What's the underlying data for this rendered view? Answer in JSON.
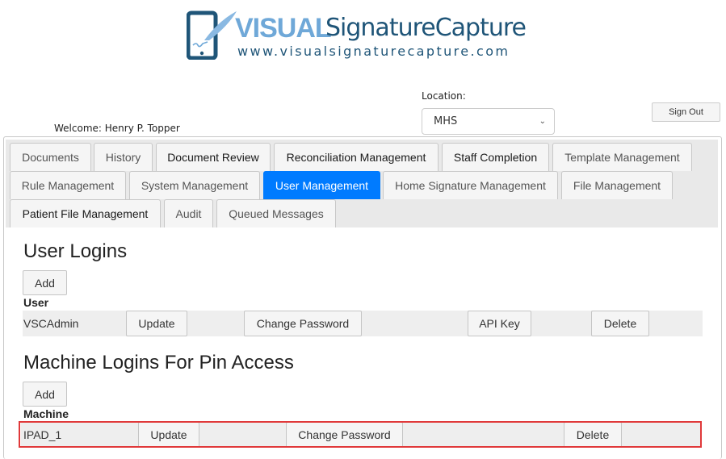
{
  "logo": {
    "brand_bold": "VISUAL",
    "brand_rest": "SignatureCapture",
    "url": "www.visualsignaturecapture.com",
    "colors": {
      "light_blue": "#6fa8d8",
      "dark_blue": "#1f5578"
    }
  },
  "header": {
    "welcome_label": "Welcome:",
    "user_name": "Henry P. Topper",
    "location_label": "Location:",
    "location_value": "MHS",
    "sign_out_label": "Sign Out"
  },
  "tabs": [
    {
      "label": "Documents",
      "active": false
    },
    {
      "label": "History",
      "active": false
    },
    {
      "label": "Document Review",
      "active": false
    },
    {
      "label": "Reconciliation Management",
      "active": false
    },
    {
      "label": "Staff Completion",
      "active": false
    },
    {
      "label": "Template Management",
      "active": false
    },
    {
      "label": "Rule Management",
      "active": false
    },
    {
      "label": "System Management",
      "active": false
    },
    {
      "label": "User Management",
      "active": true
    },
    {
      "label": "Home Signature Management",
      "active": false
    },
    {
      "label": "File Management",
      "active": false
    },
    {
      "label": "Patient File Management",
      "active": false
    },
    {
      "label": "Audit",
      "active": false
    },
    {
      "label": "Queued Messages",
      "active": false
    }
  ],
  "accent_color": "#007bff",
  "user_logins": {
    "title": "User Logins",
    "add_label": "Add",
    "column_label": "User",
    "rows": [
      {
        "name": "VSCAdmin",
        "update_label": "Update",
        "change_password_label": "Change Password",
        "api_key_label": "API Key",
        "delete_label": "Delete"
      }
    ]
  },
  "machine_logins": {
    "title": "Machine Logins For Pin Access",
    "add_label": "Add",
    "column_label": "Machine",
    "highlight_color": "#e0393a",
    "rows": [
      {
        "name": "IPAD_1",
        "update_label": "Update",
        "change_password_label": "Change Password",
        "delete_label": "Delete"
      }
    ]
  }
}
